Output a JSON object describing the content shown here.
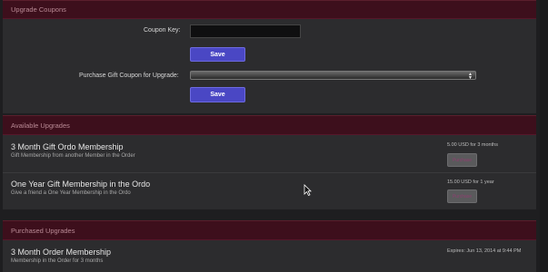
{
  "upgrade_coupons": {
    "header": "Upgrade Coupons",
    "coupon_label": "Coupon Key:",
    "coupon_value": "",
    "save_label": "Save",
    "gift_label": "Purchase Gift Coupon for Upgrade:",
    "gift_selected": "",
    "save2_label": "Save"
  },
  "available_upgrades": {
    "header": "Available Upgrades",
    "items": [
      {
        "title": "3 Month Gift Ordo Membership",
        "description": "Gift Membership from another Member in the Order",
        "price": "5.00 USD for 3 months",
        "button": "Purchase"
      },
      {
        "title": "One Year Gift Membership in the Ordo",
        "description": "Give a friend a One Year Membership in the Ordo",
        "price": "15.00 USD for 1 year",
        "button": "Purchase"
      }
    ]
  },
  "purchased_upgrades": {
    "header": "Purchased Upgrades",
    "items": [
      {
        "title": "3 Month Order Membership",
        "description": "Membership in the Order for 3 months",
        "expires": "Expires: Jun 13, 2014 at 9:44 PM"
      }
    ]
  }
}
